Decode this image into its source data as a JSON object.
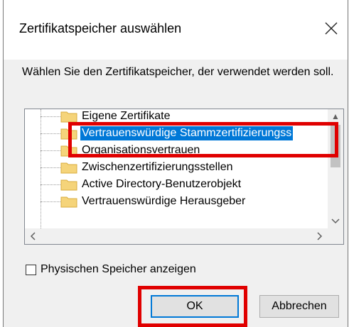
{
  "dialog": {
    "title": "Zertifikatspeicher auswählen",
    "close_glyph": "×",
    "description": "Wählen Sie den Zertifikatspeicher, der verwendet werden soll."
  },
  "tree": {
    "items": [
      {
        "label": "Eigene Zertifikate",
        "selected": false
      },
      {
        "label": "Vertrauenswürdige Stammzertifizierungss",
        "selected": true
      },
      {
        "label": "Organisationsvertrauen",
        "selected": false
      },
      {
        "label": "Zwischenzertifizierungsstellen",
        "selected": false
      },
      {
        "label": "Active Directory-Benutzerobjekt",
        "selected": false
      },
      {
        "label": "Vertrauenswürdige Herausgeber",
        "selected": false
      }
    ],
    "icon": "folder-icon"
  },
  "options": {
    "physical_store_label": "Physischen Speicher anzeigen",
    "physical_store_checked": false
  },
  "buttons": {
    "ok": "OK",
    "cancel": "Abbrechen"
  },
  "colors": {
    "accent": "#0078d7",
    "highlight": "#e00000",
    "folder": "#f5d47a"
  }
}
